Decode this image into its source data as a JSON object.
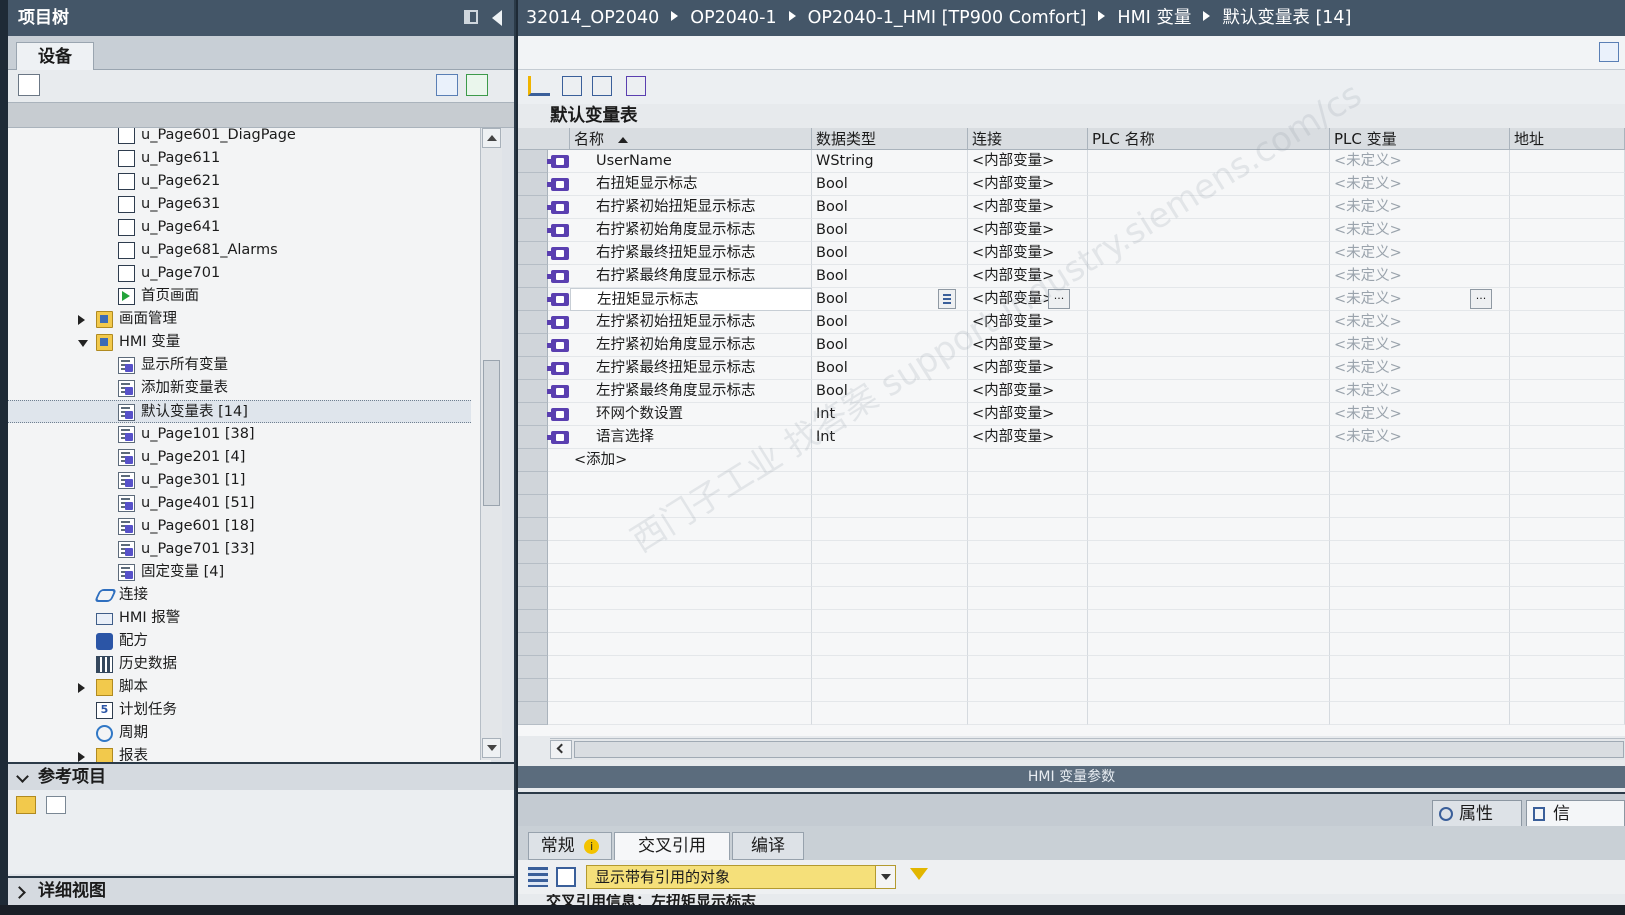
{
  "left_panel": {
    "title": "项目树",
    "tab": "设备",
    "tree": [
      {
        "label": "u_Page601_DiagPage",
        "icon": "page-icon"
      },
      {
        "label": "u_Page611",
        "icon": "page-icon"
      },
      {
        "label": "u_Page621",
        "icon": "page-icon"
      },
      {
        "label": "u_Page631",
        "icon": "page-icon"
      },
      {
        "label": "u_Page641",
        "icon": "page-icon"
      },
      {
        "label": "u_Page681_Alarms",
        "icon": "page-icon"
      },
      {
        "label": "u_Page701",
        "icon": "page-icon"
      },
      {
        "label": "首页画面",
        "icon": "start-screen-icon"
      },
      {
        "label": "画面管理",
        "icon": "screen-management-icon"
      },
      {
        "label": "HMI 变量",
        "icon": "hmi-tags-folder-icon"
      },
      {
        "label": "显示所有变量",
        "icon": "show-all-tags-icon"
      },
      {
        "label": "添加新变量表",
        "icon": "add-tag-table-icon"
      },
      {
        "label": "默认变量表 [14]",
        "icon": "tag-table-icon"
      },
      {
        "label": "u_Page101 [38]",
        "icon": "tag-table-icon"
      },
      {
        "label": "u_Page201 [4]",
        "icon": "tag-table-icon"
      },
      {
        "label": "u_Page301 [1]",
        "icon": "tag-table-icon"
      },
      {
        "label": "u_Page401 [51]",
        "icon": "tag-table-icon"
      },
      {
        "label": "u_Page601 [18]",
        "icon": "tag-table-icon"
      },
      {
        "label": "u_Page701 [33]",
        "icon": "tag-table-icon"
      },
      {
        "label": "固定变量 [4]",
        "icon": "tag-table-icon"
      },
      {
        "label": "连接",
        "icon": "connections-icon"
      },
      {
        "label": "HMI 报警",
        "icon": "hmi-alarms-icon"
      },
      {
        "label": "配方",
        "icon": "recipes-icon"
      },
      {
        "label": "历史数据",
        "icon": "historical-data-icon"
      },
      {
        "label": "脚本",
        "icon": "scripts-icon"
      },
      {
        "label": "计划任务",
        "icon": "scheduled-tasks-icon"
      },
      {
        "label": "周期",
        "icon": "cycles-icon"
      },
      {
        "label": "报表",
        "icon": "reports-icon"
      }
    ],
    "reference_projects": "参考项目",
    "details_view": "详细视图"
  },
  "breadcrumb": [
    "32014_OP2040",
    "OP2040-1",
    "OP2040-1_HMI [TP900 Comfort]",
    "HMI 变量",
    "默认变量表 [14]"
  ],
  "table": {
    "title": "默认变量表",
    "columns": [
      "名称",
      "数据类型",
      "连接",
      "PLC 名称",
      "PLC 变量",
      "地址"
    ],
    "rows": [
      {
        "name": "UserName",
        "type": "WString",
        "conn": "<内部变量>",
        "plc_name": "",
        "plc_tag": "<未定义>"
      },
      {
        "name": "右扭矩显示标志",
        "type": "Bool",
        "conn": "<内部变量>",
        "plc_name": "",
        "plc_tag": "<未定义>"
      },
      {
        "name": "右拧紧初始扭矩显示标志",
        "type": "Bool",
        "conn": "<内部变量>",
        "plc_name": "",
        "plc_tag": "<未定义>"
      },
      {
        "name": "右拧紧初始角度显示标志",
        "type": "Bool",
        "conn": "<内部变量>",
        "plc_name": "",
        "plc_tag": "<未定义>"
      },
      {
        "name": "右拧紧最终扭矩显示标志",
        "type": "Bool",
        "conn": "<内部变量>",
        "plc_name": "",
        "plc_tag": "<未定义>"
      },
      {
        "name": "右拧紧最终角度显示标志",
        "type": "Bool",
        "conn": "<内部变量>",
        "plc_name": "",
        "plc_tag": "<未定义>"
      },
      {
        "name": "左扭矩显示标志",
        "type": "Bool",
        "conn": "<内部变量>",
        "plc_name": "",
        "plc_tag": "<未定义>"
      },
      {
        "name": "左拧紧初始扭矩显示标志",
        "type": "Bool",
        "conn": "<内部变量>",
        "plc_name": "",
        "plc_tag": "<未定义>"
      },
      {
        "name": "左拧紧初始角度显示标志",
        "type": "Bool",
        "conn": "<内部变量>",
        "plc_name": "",
        "plc_tag": "<未定义>"
      },
      {
        "name": "左拧紧最终扭矩显示标志",
        "type": "Bool",
        "conn": "<内部变量>",
        "plc_name": "",
        "plc_tag": "<未定义>"
      },
      {
        "name": "左拧紧最终角度显示标志",
        "type": "Bool",
        "conn": "<内部变量>",
        "plc_name": "",
        "plc_tag": "<未定义>"
      },
      {
        "name": "环网个数设置",
        "type": "Int",
        "conn": "<内部变量>",
        "plc_name": "",
        "plc_tag": "<未定义>"
      },
      {
        "name": "语言选择",
        "type": "Int",
        "conn": "<内部变量>",
        "plc_name": "",
        "plc_tag": "<未定义>"
      }
    ],
    "add_row": "<添加>",
    "dots": "..."
  },
  "params_bar": "HMI 变量参数",
  "inspector": {
    "top_tabs": [
      "属性",
      "信"
    ],
    "tabs": [
      "常规",
      "交叉引用",
      "编译"
    ],
    "filter_value": "显示带有引用的对象",
    "crossref_line": "交叉引用信息：左扭矩显示标志"
  },
  "watermark": "西门子工业 找答案 support.industry.siemens.com/cs"
}
